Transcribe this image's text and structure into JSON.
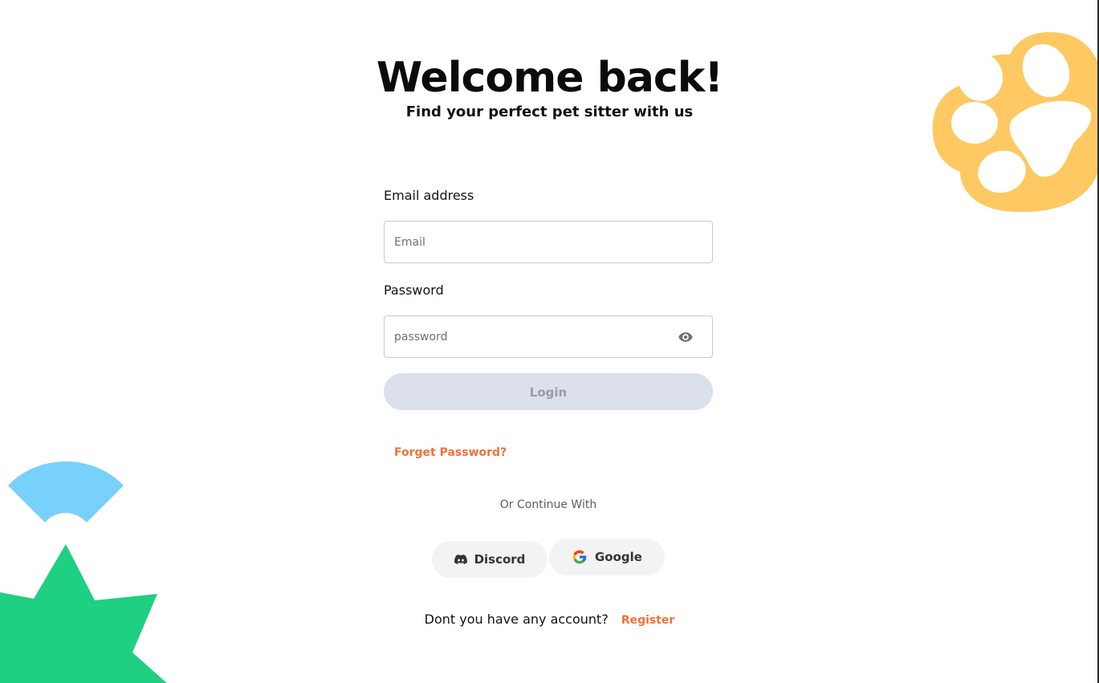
{
  "header": {
    "title": "Welcome back!",
    "subtitle": "Find your perfect pet sitter with us"
  },
  "form": {
    "email_label": "Email address",
    "email_placeholder": "Email",
    "email_value": "",
    "password_label": "Password",
    "password_placeholder": "password",
    "password_value": "",
    "password_toggle_icon": "eye-icon",
    "login_label": "Login",
    "forgot_label": "Forget Password?"
  },
  "social": {
    "divider_text": "Or Continue With",
    "discord_label": "Discord",
    "discord_icon": "discord-icon",
    "google_label": "Google",
    "google_icon": "google-icon"
  },
  "footer": {
    "prompt": "Dont you have any account?",
    "register_label": "Register"
  },
  "colors": {
    "accent": "#f07238",
    "login_disabled_bg": "#dcdfec",
    "paw": "#fec962",
    "fan": "#78d0fc",
    "star": "#1fcf82"
  }
}
